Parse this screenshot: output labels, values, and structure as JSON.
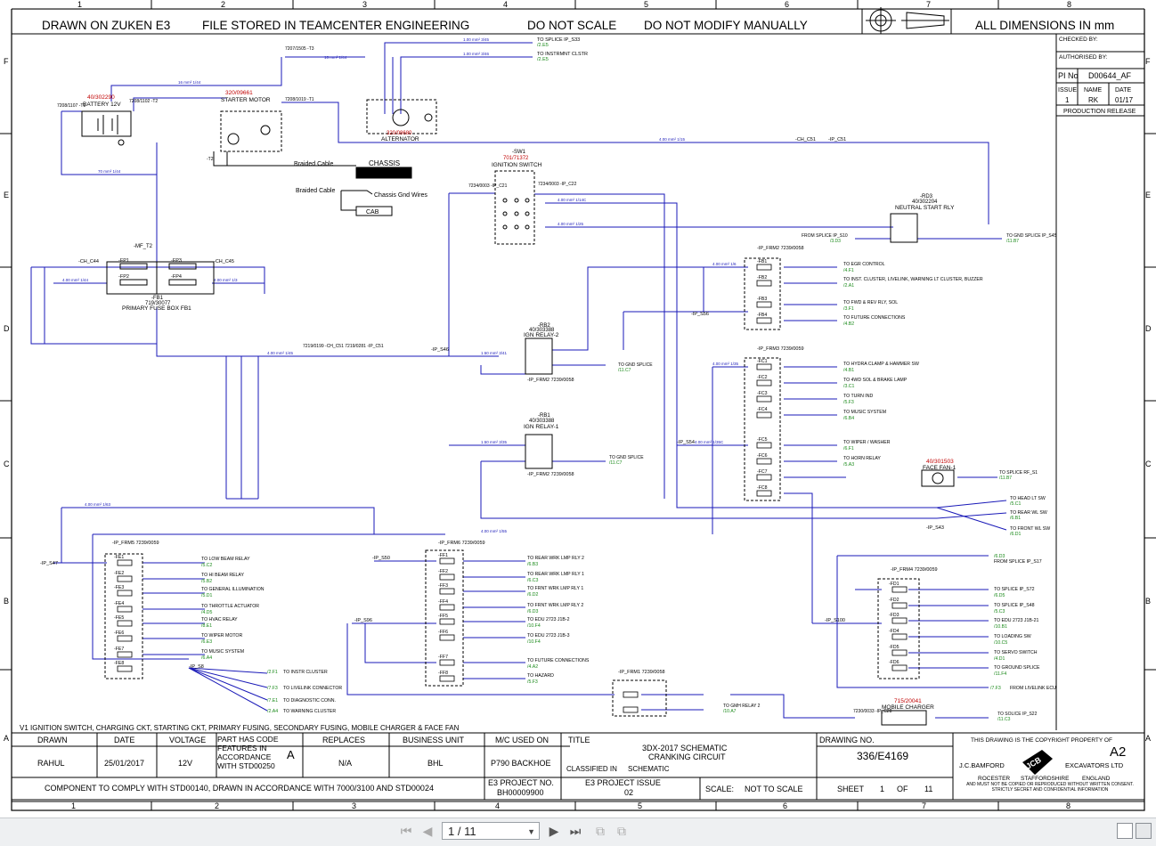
{
  "header": {
    "drawn_on": "DRAWN ON ZUKEN E3",
    "file_stored": "FILE STORED IN TEAMCENTER ENGINEERING",
    "do_not_scale": "DO NOT SCALE",
    "do_not_modify": "DO NOT MODIFY MANUALLY",
    "dimensions": "ALL DIMENSIONS IN mm"
  },
  "grid": {
    "columns": [
      "1",
      "2",
      "3",
      "4",
      "5",
      "6",
      "7",
      "8"
    ],
    "rows": [
      "F",
      "E",
      "D",
      "C",
      "B",
      "A"
    ]
  },
  "approval": {
    "checked_by": "CHECKED BY:",
    "authorised_by": "AUTHORISED BY:",
    "pi_no_label": "PI No",
    "pi_no": "D00644_AF",
    "issue_label": "ISSUE",
    "name_label": "NAME",
    "date_label": "DATE",
    "issue": "1",
    "name": "RK",
    "date": "01/17",
    "release": "PRODUCTION RELEASE"
  },
  "components": {
    "battery_ref": "40/302290",
    "battery": "BATTERY 12V",
    "battery_t1": "7208/1107 -T1",
    "battery_t2": "7208/1102 -T2",
    "starter_ref": "320/09661",
    "starter": "STARTER MOTOR",
    "starter_t1": "7208/1019 -T1",
    "starter_t2": "-T2",
    "alternator_ref": "320/08680",
    "alternator": "ALTERNATOR",
    "alt_wire1": "TO SPLICE IP_S33",
    "alt_wire1_ref": "/2.E5",
    "alt_wire2": "TO INSTRMNT CLSTR",
    "alt_wire2_ref": "/2.E5",
    "t3": "7207/1505 -T3",
    "braided1": "Braided Cable",
    "chassis": "CHASSIS",
    "braided2": "Braided Cable",
    "chassis_gnd": "Chassis Gnd Wires",
    "cab": "CAB",
    "sw1": "-SW1",
    "sw1_ref": "701/71372",
    "ignition_switch": "IGNITION SWITCH",
    "ip_c21": "7234/0003 -IP_C21",
    "ip_c22": "7234/0003 -IP_C22",
    "ch_c51_top": "-CH_C51",
    "ip_c51_top": "-IP_C51",
    "rd3": "-RD3",
    "rd3_ref": "40/302204",
    "neutral_start": "NEUTRAL START RLY",
    "from_splice_s10": "FROM SPLICE IP_S10",
    "from_splice_s10_ref": "/3.D3",
    "to_gnd_s45": "TO GND SPLICE IP_S45",
    "to_gnd_s45_ref": "/11.B7",
    "mf_t2": "-MF_T2",
    "fb1": "-FB1",
    "fb1_ref": "719/30077",
    "primary_fuse": "PRIMARY FUSE BOX FB1",
    "ch_c44": "-CH_C44",
    "ch_c45": "-CH_C45",
    "fuses_primary": [
      "-FP1",
      "-FP2",
      "-FP3",
      "-FP4"
    ],
    "rb2": "-RB2",
    "rb2_ref": "40/303388",
    "ign_relay2": "IGN RELAY-2",
    "rb1": "-RB1",
    "rb1_ref": "40/303388",
    "ign_relay1": "IGN RELAY-1",
    "to_gnd_splice": "TO GND SPLICE",
    "to_gnd_c7": "/11.C7",
    "to_gnd_splice_b": "TO GND SPLICE",
    "to_gnd_c7_b": "/11.C7",
    "ip_frm2": "-IP_FRM2 7239/0058",
    "ip_s46": "-IP_S46",
    "ip_s56": "-IP_S56",
    "ip_s54": "-IP_S54",
    "ip_s43": "-IP_S43",
    "ip_s47": "-IP_S47",
    "ip_s50": "-IP_S50",
    "ip_s96": "-IP_S96",
    "ip_s100": "-IP_S100",
    "ip_s8": "-IP_S8",
    "ch_c51_ip_c51": "7219/0199 -CH_C51   7219/0281 -IP_C51",
    "face_fan_ref": "40/301503",
    "face_fan": "FACE FAN-1",
    "mobile_charger_ref": "715/20041",
    "mobile_charger": "MOBILE CHARGER",
    "ip_c28": "7230/0033 -IP_C28",
    "to_splice_s22": "TO SOLICE IP_S22",
    "to_splice_s22_ref": "/11.C3",
    "ip_frm1": "-IP_FRM1 7239/0058",
    "to_gmh_relay": "TO GMH RELAY 2",
    "to_gmh_relay_ref": "/10.A7",
    "to_splice_rf": "TO SPLICE RF_S1",
    "to_splice_rf_ref": "/11.B7"
  },
  "fuse_groups": [
    {
      "title": "-IP_FRM2 7239/0058",
      "items": [
        {
          "fuse": "-FB1",
          "to": "TO EGR CONTROL",
          "ref": "/4.F1"
        },
        {
          "fuse": "-FB2",
          "to": "TO INST. CLUSTER, LIVELINK, WARNING LT CLUSTER, BUZZER",
          "ref": "/2.A1"
        },
        {
          "fuse": "-FB3",
          "to": "TO FWD & REV RLY, SOL",
          "ref": "/3.F1"
        },
        {
          "fuse": "-FB4",
          "to": "TO FUTURE CONNECTIONS",
          "ref": "/4.B2"
        }
      ]
    },
    {
      "title": "-IP_FRM3 7239/0059",
      "items": [
        {
          "fuse": "-FC1",
          "to": "TO HYDRA CLAMP & HAMMER SW",
          "ref": "/4.B1"
        },
        {
          "fuse": "-FC2",
          "to": "TO 4WD SOL & BRAKE LAMP",
          "ref": "/3.C1"
        },
        {
          "fuse": "-FC3",
          "to": "TO TURN IND",
          "ref": "/5.F3"
        },
        {
          "fuse": "-FC4",
          "to": "TO MUSIC SYSTEM",
          "ref": "/6.B4"
        },
        {
          "fuse": "-FC5",
          "to": "TO WIPER / WASHER",
          "ref": "/6.F1"
        },
        {
          "fuse": "-FC6",
          "to": "TO HORN RELAY",
          "ref": "/5.A3"
        },
        {
          "fuse": "-FC7",
          "to": "",
          "ref": ""
        },
        {
          "fuse": "-FC8",
          "to": "",
          "ref": ""
        }
      ]
    },
    {
      "title": "-IP_FRM5 7239/0059",
      "items": [
        {
          "fuse": "-FE1",
          "to": "TO LOW BEAM RELAY",
          "ref": "/5.C2"
        },
        {
          "fuse": "-FE2",
          "to": "TO HI BEAM RELAY",
          "ref": "/5.B2"
        },
        {
          "fuse": "-FE3",
          "to": "TO GENERAL ILLUMINATION",
          "ref": "/5.D1"
        },
        {
          "fuse": "-FE4",
          "to": "TO THROTTLE ACTUATOR",
          "ref": "/4.D5"
        },
        {
          "fuse": "-FE5",
          "to": "TO HVAC RELAY",
          "ref": "/8.E1"
        },
        {
          "fuse": "-FE6",
          "to": "TO WIPER MOTOR",
          "ref": "/6.E3"
        },
        {
          "fuse": "-FE7",
          "to": "TO MUSIC SYSTEM",
          "ref": "/6.A4"
        },
        {
          "fuse": "-FE8",
          "to": "",
          "ref": ""
        }
      ]
    },
    {
      "title": "-IP_FRM6 7239/0059",
      "items": [
        {
          "fuse": "-FF1",
          "to": "TO REAR WRK LMP RLY 2",
          "ref": "/6.B3"
        },
        {
          "fuse": "-FF2",
          "to": "TO REAR WRK LMP RLY 1",
          "ref": "/6.C3"
        },
        {
          "fuse": "-FF3",
          "to": "TO FRNT WRK LMP RLY 1",
          "ref": "/6.D2"
        },
        {
          "fuse": "-FF4",
          "to": "TO FRNT WRK LMP RLY 2",
          "ref": "/6.D3"
        },
        {
          "fuse": "-FF5",
          "to": "TO EDU 2723 J1B-2",
          "ref": "/10.F4"
        },
        {
          "fuse": "-FF6",
          "to": "TO EDU 2723 J1B-3",
          "ref": "/10.F4"
        },
        {
          "fuse": "-FF7",
          "to": "TO FUTURE CONNECTIONS",
          "ref": "/4.A2"
        },
        {
          "fuse": "-FF8",
          "to": "TO HAZARD",
          "ref": "/5.F3"
        }
      ]
    },
    {
      "title": "-IP_FRM4 7239/0059",
      "items": [
        {
          "fuse": "-FD1",
          "to": "TO SPLICE IP_S72",
          "ref": "/6.D5"
        },
        {
          "fuse": "-FD2",
          "to": "TO SPLICE IP_S48",
          "ref": "/5.C3"
        },
        {
          "fuse": "-FD3",
          "to": "TO EDU 2723 J1B-21",
          "ref": "/10.B1"
        },
        {
          "fuse": "-FD4",
          "to": "TO LOADING SW",
          "ref": "/10.C5"
        },
        {
          "fuse": "-FD5",
          "to": "TO SERVO SWITCH",
          "ref": "/4.D1"
        },
        {
          "fuse": "-FD6",
          "to": "TO GROUND SPLICE",
          "ref": "/11.F4"
        }
      ]
    }
  ],
  "misc_wires": {
    "head_lt": "TO HEAD LT SW",
    "head_lt_ref": "/5.C1",
    "rear_wl": "TO REAR WL SW",
    "rear_wl_ref": "/6.B1",
    "front_wl": "TO FRONT WL SW",
    "front_wl_ref": "/6.D1",
    "from_splice_s17": "FROM SPLICE IP_S17",
    "from_splice_s17_ref": "/6.D3",
    "from_livelink": "FROM LIVELINK ECU",
    "from_livelink_ref": "/7.F3",
    "instr": "TO INSTR CLUSTER",
    "instr_ref": "/2.F1",
    "livelink": "TO LIVELINK CONNECTOR",
    "livelink_ref": "/7.F3",
    "diag": "TO DIAGNOSTIC CONN.",
    "diag_ref": "/7.E1",
    "warn": "TO WARNING CLUSTER",
    "warn_ref": "/2.A4"
  },
  "version_note": "V1   IGNITION SWITCH, CHARGING CKT, STARTING CKT, PRIMARY FUSING, SECONDARY FUSING, MOBILE CHARGER & FACE FAN",
  "title_block": {
    "drawn_label": "DRAWN",
    "drawn": "RAHUL",
    "date_label": "DATE",
    "date": "25/01/2017",
    "voltage_label": "VOLTAGE",
    "voltage": "12V",
    "std_note": "PART HAS CODE FEATURES IN ACCORDANCE WITH STD00250",
    "std_letter": "A",
    "replaces_label": "REPLACES",
    "replaces": "N/A",
    "business_label": "BUSINESS UNIT",
    "business": "BHL",
    "mc_label": "M/C USED ON",
    "mc": "P790 BACKHOE",
    "title_label": "TITLE",
    "title1": "3DX-2017 SCHEMATIC",
    "title2": "CRANKING CIRCUIT",
    "classified": "CLASSIFIED IN",
    "classified_val": "SCHEMATIC",
    "drawing_no_label": "DRAWING NO.",
    "drawing_no": "336/E4169",
    "copyright": "THIS DRAWING IS THE COPYRIGHT PROPERTY OF",
    "size": "A2",
    "company": "J.C.BAMFORD",
    "company2": "EXCAVATORS LTD",
    "logo": "JCB",
    "loc1": "ROCESTER",
    "loc2": "STAFFORDSHIRE",
    "loc3": "ENGLAND",
    "fine": "AND MUST NOT BE COPIED OR REPRODUCED WITHOUT WRITTEN CONSENT. STRICTLY SECRET AND CONFIDENTIAL INFORMATION",
    "comply": "COMPONENT TO COMPLY WITH STD00140, DRAWN IN ACCORDANCE WITH 7000/3100 AND STD00024",
    "e3_project_label": "E3 PROJECT NO.",
    "e3_project": "BH00009900",
    "e3_issue_label": "E3 PROJECT ISSUE",
    "e3_issue": "02",
    "scale_label": "SCALE:",
    "scale": "NOT TO SCALE",
    "sheet_label": "SHEET",
    "sheet": "1",
    "of_label": "OF",
    "sheets": "11"
  },
  "viewer": {
    "page_indicator": "1 / 11"
  }
}
